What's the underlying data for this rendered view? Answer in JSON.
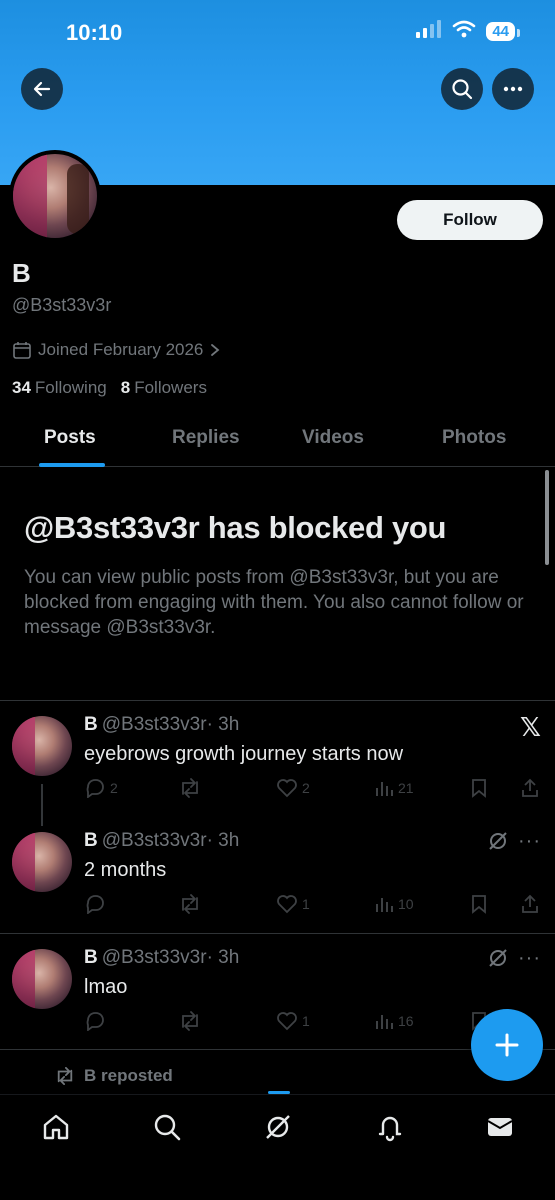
{
  "status_bar": {
    "time": "10:10",
    "battery": "44"
  },
  "profile": {
    "name": "B",
    "handle": "@B3st33v3r",
    "joined": "Joined February 2026",
    "following_count": "34",
    "following_label": "Following",
    "followers_count": "8",
    "followers_label": "Followers",
    "follow_label": "Follow"
  },
  "tabs": [
    "Posts",
    "Replies",
    "Videos",
    "Photos"
  ],
  "blocked": {
    "title": "@B3st33v3r has blocked you",
    "message": "You can view public posts from @B3st33v3r, but you are blocked from engaging with them. You also cannot follow or message @B3st33v3r."
  },
  "posts": [
    {
      "name": "B",
      "handle": "@B3st33v3r",
      "time": "· 3h",
      "text": "eyebrows growth journey starts now",
      "replies": "2",
      "likes": "2",
      "views": "21"
    },
    {
      "name": "B",
      "handle": "@B3st33v3r",
      "time": "· 3h",
      "text": "2 months",
      "replies": "",
      "likes": "1",
      "views": "10"
    },
    {
      "name": "B",
      "handle": "@B3st33v3r",
      "time": "· 3h",
      "text": "lmao",
      "replies": "",
      "likes": "1",
      "views": "16"
    }
  ],
  "repost_label": "B reposted",
  "colors": {
    "accent": "#1d9bf0",
    "banner": "#2a9cf0",
    "muted": "#71767b"
  }
}
